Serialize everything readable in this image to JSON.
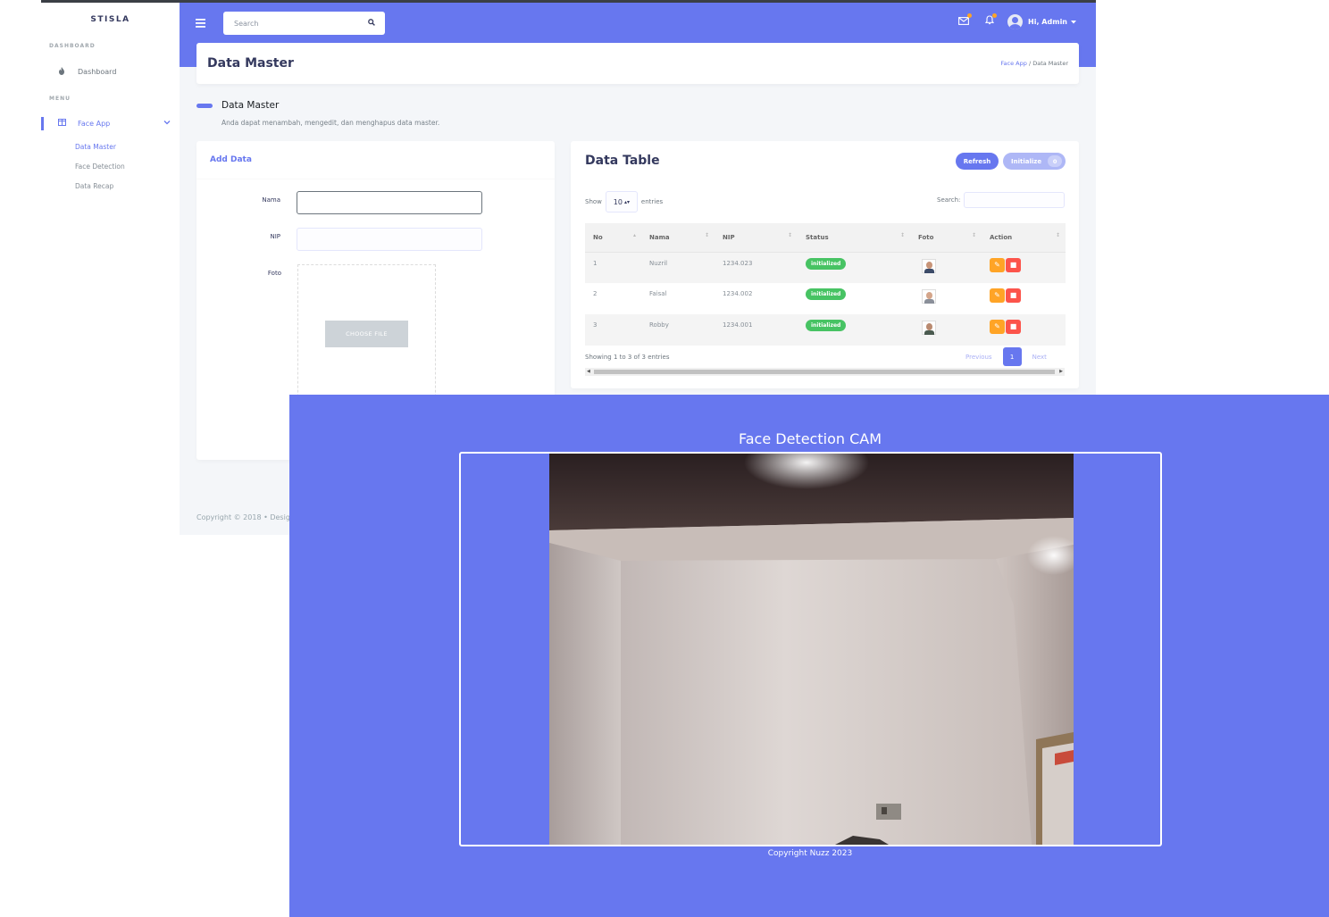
{
  "sidebar": {
    "brand": "STISLA",
    "sections": [
      {
        "header": "DASHBOARD"
      },
      {
        "header": "MENU"
      }
    ],
    "items": [
      {
        "label": "Dashboard",
        "icon": "fire-icon"
      },
      {
        "label": "Face App",
        "icon": "columns-icon",
        "active": true
      }
    ],
    "sub_items": [
      {
        "label": "Data Master",
        "active": true
      },
      {
        "label": "Face Detection"
      },
      {
        "label": "Data Recap"
      }
    ]
  },
  "topbar": {
    "search_placeholder": "Search",
    "user_label": "Hi, Admin"
  },
  "header": {
    "title": "Data Master",
    "breadcrumb": [
      "Face App",
      "Data Master"
    ]
  },
  "section": {
    "title": "Data Master",
    "lead": "Anda dapat menambah, mengedit, dan menghapus data master."
  },
  "form": {
    "title": "Add Data",
    "fields": [
      {
        "label": "Nama",
        "value": ""
      },
      {
        "label": "NIP",
        "value": ""
      },
      {
        "label": "Foto"
      }
    ],
    "choose_file": "CHOOSE FILE"
  },
  "table": {
    "title": "Data Table",
    "refresh_label": "Refresh",
    "initialize_label": "Initialize",
    "initialize_count": "0",
    "show_label": "Show",
    "entries_value": "10",
    "entries_label": "entries",
    "search_label": "Search:",
    "columns": [
      "No",
      "Nama",
      "NIP",
      "Status",
      "Foto",
      "Action"
    ],
    "rows": [
      {
        "no": "1",
        "nama": "Nuzril",
        "nip": "1234.023",
        "status": "initialized"
      },
      {
        "no": "2",
        "nama": "Faisal",
        "nip": "1234.002",
        "status": "initialized"
      },
      {
        "no": "3",
        "nama": "Robby",
        "nip": "1234.001",
        "status": "initialized"
      }
    ],
    "info": "Showing 1 to 3 of 3 entries",
    "pagination": {
      "prev": "Previous",
      "page": "1",
      "next": "Next"
    }
  },
  "footer": {
    "text": "Copyright © 2018 • Desig"
  },
  "cam": {
    "title": "Face Detection CAM",
    "copyright": "Copyright Nuzz 2023"
  },
  "colors": {
    "primary": "#6777ef",
    "success": "#47c363",
    "warning": "#ffa426",
    "danger": "#fc544b"
  }
}
